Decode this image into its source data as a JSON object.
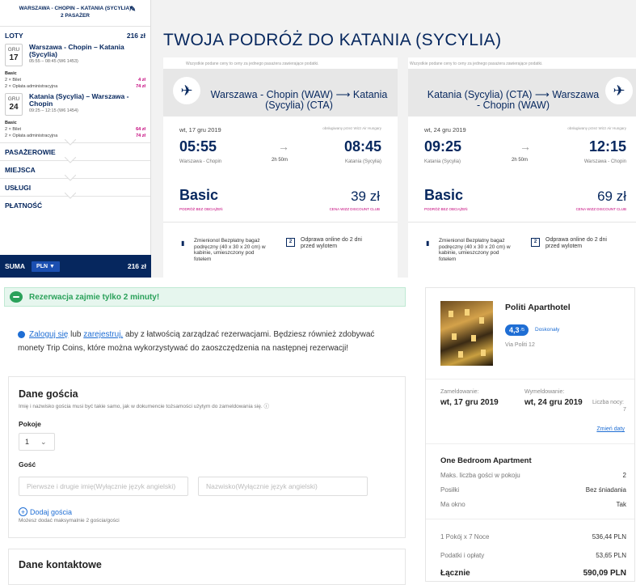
{
  "sidebar": {
    "route_line1": "WARSZAWA - CHOPIN – KATANIA (SYCYLIA)",
    "route_line2": "2 PASAŻER",
    "flights_label": "LOTY",
    "flights_total": "216 zł",
    "flights": [
      {
        "month": "GRU",
        "day": "17",
        "name": "Warszawa - Chopin – Katania (Sycylia)",
        "time": "05:55 – 08:45 (W6 1453)",
        "fare": "Basic",
        "ticket": "2 × Bilet",
        "ticket_price": "4 zł",
        "fee": "2 × Opłata administracyjna",
        "fee_price": "74 zł"
      },
      {
        "month": "GRU",
        "day": "24",
        "name": "Katania (Sycylia) – Warszawa - Chopin",
        "time": "09:25 – 12:15 (W6 1454)",
        "fare": "Basic",
        "ticket": "2 × Bilet",
        "ticket_price": "64 zł",
        "fee": "2 × Opłata administracyjna",
        "fee_price": "74 zł"
      }
    ],
    "sections": [
      "PASAŻEROWIE",
      "MIEJSCA",
      "USŁUGI",
      "PŁATNOŚĆ"
    ],
    "sum_label": "SUMA",
    "currency": "PLN ▼",
    "sum_total": "216 zł"
  },
  "title": "TWOJA PODRÓŻ DO KATANIA (SYCYLIA)",
  "cards": [
    {
      "note": "Wszystkie podane ceny to ceny za jednego pasażera zawierające podatki.",
      "route": "Warszawa - Chopin (WAW) ⟶ Katania (Sycylia) (CTA)",
      "date": "wt, 17 gru 2019",
      "operator": "obsługiwany przez Wizz Air Hungary",
      "dep": "05:55",
      "arr": "08:45",
      "dep_apt": "Warszawa - Chopin",
      "arr_apt": "Katania (Sycylia)",
      "duration": "2h 50m",
      "fare": "Basic",
      "fare_sub": "PODRÓŻ BEZ OBCIĄŻEŃ",
      "price": "39 zł",
      "club": "CENA WIZZ DISCOUNT CLUB",
      "bag": "Zmienionol Bezpłatny bagaż podręczny (40 x 30 x 20 cm) w kabinie, umieszczony pod fotelem",
      "checkin_num": "2",
      "checkin": "Odprawa online do 2 dni przed wylotem"
    },
    {
      "note": "Wszystkie podane ceny to ceny za jednego pasażera zawierające podatki.",
      "route": "Katania (Sycylia) (CTA) ⟶ Warszawa - Chopin (WAW)",
      "date": "wt, 24 gru 2019",
      "operator": "obsługiwany przez Wizz Air Hungary",
      "dep": "09:25",
      "arr": "12:15",
      "dep_apt": "Katania (Sycylia)",
      "arr_apt": "Warszawa - Chopin",
      "duration": "2h 50m",
      "fare": "Basic",
      "fare_sub": "PODRÓŻ BEZ OBCIĄŻEŃ",
      "price": "69 zł",
      "club": "CENA WIZZ DISCOUNT CLUB",
      "bag": "Zmienionol Bezpłatny bagaż podręczny (40 x 30 x 20 cm) w kabinie, umieszczony pod fotelem",
      "checkin_num": "2",
      "checkin": "Odprawa online do 2 dni przed wylotem"
    }
  ],
  "booking": {
    "banner": "Rezerwacja zajmie tylko 2 minuty!",
    "login_link": "Zaloguj się",
    "or": "lub",
    "register_link": "zarejestruj,",
    "login_text": "aby z łatwością zarządzać rezerwacjami. Będziesz również zdobywać monety Trip Coins, które można wykorzystywać do zaoszczędzenia na następnej rezerwacji!",
    "guest_title": "Dane gościa",
    "guest_help": "Imię i nazwisko gościa musi być takie samo, jak w dokumencie tożsamości użytym do zameldowania się. ⓘ",
    "rooms_label": "Pokoje",
    "rooms_value": "1",
    "guest_label": "Gość",
    "first_placeholder": "Pierwsze i drugie imię(Wyłącznie język angielski)",
    "last_placeholder": "Nazwisko(Wyłącznie język angielski)",
    "add_guest": "Dodaj gościa",
    "add_guest_note": "Możesz dodać maksymalnie 2 gościa/gości",
    "contact_title": "Dane kontaktowe"
  },
  "hotel": {
    "name": "Politi Aparthotel",
    "rating": "4,3",
    "rating_max": "/5",
    "rating_text": "Doskonały",
    "address": "Via Politi 12",
    "checkin_label": "Zameldowanie:",
    "checkin": "wt, 17 gru 2019",
    "checkout_label": "Wymeldowanie:",
    "checkout": "wt, 24 gru 2019",
    "nights_label": "Liczba nocy:",
    "nights": "7",
    "change_dates": "Zmień daty",
    "room_name": "One Bedroom Apartment",
    "details": [
      {
        "k": "Maks. liczba gości w pokoju",
        "v": "2"
      },
      {
        "k": "Posiłki",
        "v": "Bez śniadania"
      },
      {
        "k": "Ma okno",
        "v": "Tak"
      }
    ],
    "price_rows": [
      {
        "k": "1 Pokój x 7 Noce",
        "v": "536,44 PLN"
      },
      {
        "k": "Podatki i opłaty",
        "v": "53,65 PLN"
      }
    ],
    "total_label": "Łącznie",
    "total": "590,09 PLN"
  }
}
